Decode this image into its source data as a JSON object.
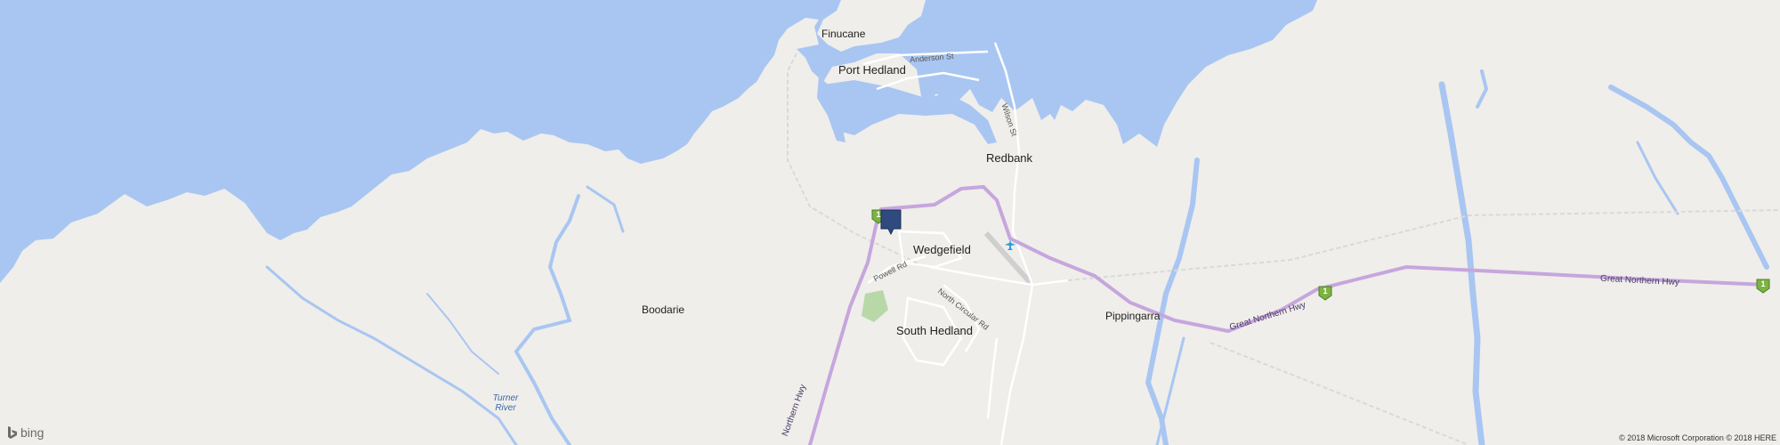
{
  "map": {
    "colors": {
      "land": "#efeeea",
      "water": "#a9c6f2",
      "highway": "#c6a6dd",
      "road": "#ffffff",
      "shield": "#7cb342",
      "pin": "#2f4a7f",
      "park": "#b9d8a8"
    },
    "places": {
      "finucane": "Finucane",
      "port_hedland": "Port Hedland",
      "redbank": "Redbank",
      "wedgefield": "Wedgefield",
      "south_hedland": "South Hedland",
      "boodarie": "Boodarie",
      "pippingarra": "Pippingarra"
    },
    "rivers": {
      "turner": "Turner River"
    },
    "roads": {
      "anderson": "Anderson St",
      "wilson": "Wilson St",
      "powell": "Powell Rd",
      "north_circular": "North Circular Rd",
      "great_northern_1": "Great Northern Hwy",
      "great_northern_2": "Great Northern Hwy",
      "northern_hwy": "Northern Hwy"
    },
    "route_shield": "1",
    "pin_icon": "location-pin-icon",
    "airport_icon": "airplane-icon"
  },
  "footer": {
    "brand_icon": "bing-logo-icon",
    "brand": "bing",
    "copyright": "© 2018 Microsoft Corporation © 2018 HERE"
  }
}
